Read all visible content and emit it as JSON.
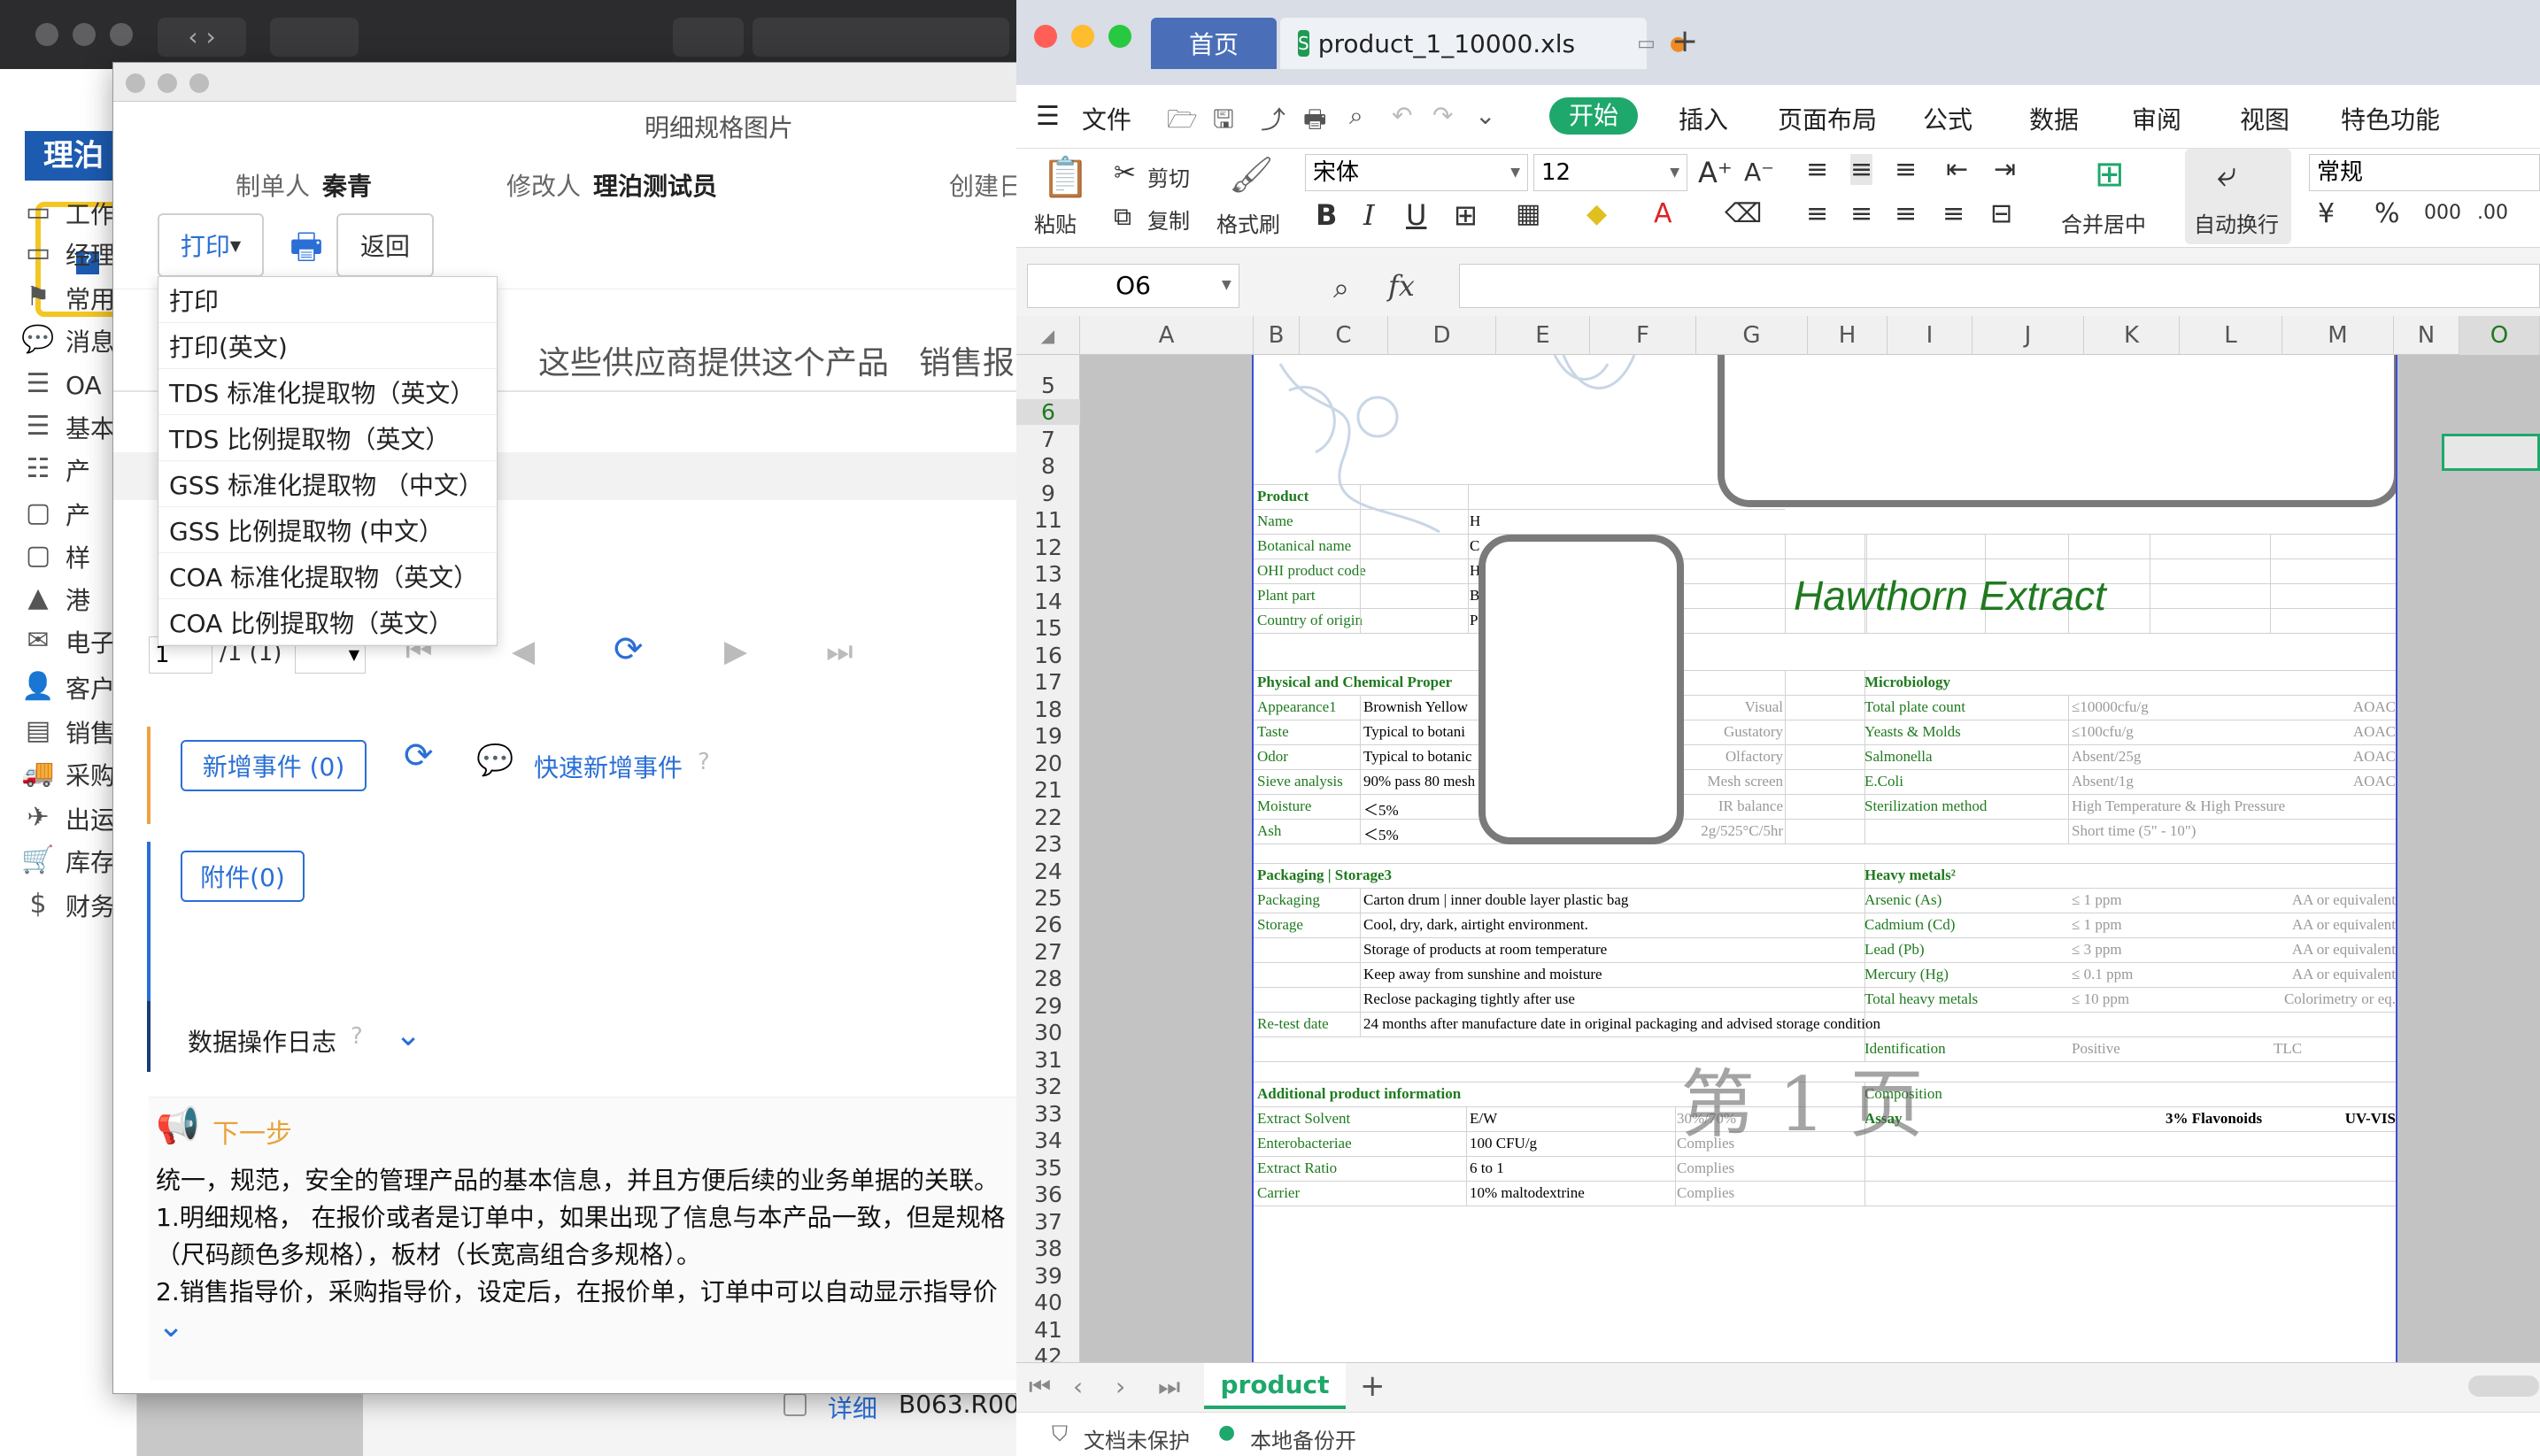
{
  "background_app": {
    "nav": [
      "工作",
      "经理",
      "常用",
      "消息",
      "OA",
      "基本",
      "产",
      "产",
      "样",
      "港",
      "电子",
      "客户",
      "销售",
      "采购",
      "出运",
      "库存",
      "财务"
    ],
    "logo": "理泊",
    "table_fragment": {
      "link": "详细",
      "code": "B063.R00"
    }
  },
  "dialog": {
    "title": "明细规格图片",
    "maker_label": "制单人",
    "maker": "秦青",
    "modifier_label": "修改人",
    "modifier": "理泊测试员",
    "created_label": "创建日",
    "print_label": "打印",
    "return_label": "返回",
    "print_menu": [
      "打印",
      "打印(英文)",
      "TDS 标准化提取物（英文）",
      "TDS 比例提取物（英文）",
      "GSS 标准化提取物 （中文）",
      "GSS 比例提取物 (中文）",
      "COA 标准化提取物（英文）",
      "COA 比例提取物（英文）"
    ],
    "tabs": [
      "这些供应商提供这个产品",
      "销售报"
    ],
    "pager": {
      "page": "1",
      "total": "/1 (1)"
    },
    "add_event": "新增事件 (0)",
    "quick_add_event": "快速新增事件",
    "attachment": "附件(0)",
    "log_title": "数据操作日志",
    "next_title": "下一步",
    "next_lines": [
      "统一，规范，安全的管理产品的基本信息，并且方便后续的业务单据的关联。",
      "1.明细规格， 在报价或者是订单中，如果出现了信息与本产品一致，但是规格",
      "（尺码颜色多规格），板材（长宽高组合多规格）。",
      "2.销售指导价，采购指导价，设定后，在报价单，订单中可以自动显示指导价"
    ]
  },
  "spreadsheet": {
    "tabs": {
      "home": "首页",
      "file": "product_1_10000.xls"
    },
    "menu": [
      "文件",
      "开始",
      "插入",
      "页面布局",
      "公式",
      "数据",
      "审阅",
      "视图",
      "特色功能"
    ],
    "ribbon": {
      "paste": "粘贴",
      "cut": "剪切",
      "copy": "复制",
      "format_painter": "格式刷",
      "font": "宋体",
      "size": "12",
      "merge": "合并居中",
      "wrap": "自动换行",
      "number_format": "常规"
    },
    "cell_ref": "O6",
    "fx": "fx",
    "columns": [
      "A",
      "B",
      "C",
      "D",
      "E",
      "F",
      "G",
      "H",
      "I",
      "J",
      "K",
      "L",
      "M",
      "N",
      "O"
    ],
    "rows": [
      "5",
      "6",
      "7",
      "8",
      "9",
      "11",
      "12",
      "13",
      "14",
      "15",
      "16",
      "17",
      "18",
      "19",
      "20",
      "21",
      "22",
      "23",
      "24",
      "25",
      "26",
      "27",
      "28",
      "29",
      "30",
      "31",
      "32",
      "33",
      "34",
      "35",
      "36",
      "37",
      "38",
      "39",
      "40",
      "41",
      "42"
    ],
    "doc_title": "Hawthorn Extract",
    "watermark": "第 1 页",
    "product": {
      "header": "Product",
      "labels": [
        "Name",
        "Botanical name",
        "OHI product code",
        "Plant part",
        "Country of origin"
      ],
      "initials": [
        "H",
        "C",
        "H",
        "B",
        "P"
      ]
    },
    "physical": {
      "header": "Physical and Chemical Proper",
      "rows": [
        [
          "Appearance1",
          "Brownish Yellow",
          "Visual"
        ],
        [
          "Taste",
          "Typical to botani",
          "Gustatory"
        ],
        [
          "Odor",
          "Typical to botanic",
          "Olfactory"
        ],
        [
          "Sieve analysis",
          "90% pass 80 mesh",
          "Mesh screen"
        ],
        [
          "Moisture",
          "＜5%",
          "IR balance"
        ],
        [
          "Ash",
          "＜5%",
          "2g/525°C/5hr"
        ]
      ]
    },
    "micro": {
      "header": "Microbiology",
      "rows": [
        [
          "Total plate count",
          "≤10000cfu/g",
          "AOAC"
        ],
        [
          "Yeasts & Molds",
          "≤100cfu/g",
          "AOAC"
        ],
        [
          "Salmonella",
          "Absent/25g",
          "AOAC"
        ],
        [
          "E.Coli",
          "Absent/1g",
          "AOAC"
        ],
        [
          "Sterilization method",
          "High Temperature & High Pressure",
          ""
        ],
        [
          "",
          "Short time (5\" - 10\")",
          ""
        ]
      ]
    },
    "packaging": {
      "header": "Packaging | Storage3",
      "rows": [
        [
          "Packaging",
          "Carton drum | inner double layer plastic bag"
        ],
        [
          "Storage",
          "Cool, dry, dark, airtight environment."
        ],
        [
          "",
          "Storage of products at room temperature"
        ],
        [
          "",
          "Keep away from sunshine and moisture"
        ],
        [
          "",
          "Reclose packaging tightly after use"
        ],
        [
          "Re-test date",
          "24 months after manufacture date in original packaging and advised storage condition"
        ]
      ]
    },
    "heavy": {
      "header": "Heavy metals²",
      "rows": [
        [
          "Arsenic (As)",
          "≤ 1 ppm",
          "AA or equivalent"
        ],
        [
          "Cadmium (Cd)",
          "≤ 1 ppm",
          "AA or equivalent"
        ],
        [
          "Lead (Pb)",
          "≤ 3 ppm",
          "AA or equivalent"
        ],
        [
          "Mercury  (Hg)",
          "≤ 0.1 ppm",
          "AA or equivalent"
        ],
        [
          "Total heavy metals",
          "≤ 10 ppm",
          "Colorimetry or eq."
        ]
      ],
      "identification": [
        "Identification",
        "Positive",
        "TLC"
      ],
      "composition": "Composition",
      "assay": [
        "Assay",
        "3% Flavonoids",
        "UV-VIS"
      ]
    },
    "additional": {
      "header": "Additional  product information",
      "rows": [
        [
          "Extract Solvent",
          "E/W",
          "30%/70%"
        ],
        [
          "Enterobacteriae",
          "100 CFU/g",
          "Complies"
        ],
        [
          "Extract Ratio",
          "6 to 1",
          "Complies"
        ],
        [
          "Carrier",
          "10% maltodextrine",
          "Complies"
        ]
      ]
    },
    "sheet_tab": "product",
    "status": {
      "protect": "文档未保护",
      "backup": "本地备份开"
    }
  }
}
